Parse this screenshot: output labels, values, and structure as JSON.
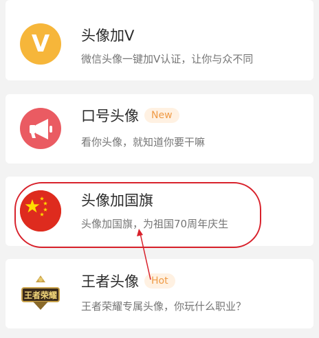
{
  "items": [
    {
      "title": "头像加V",
      "subtitle": "微信头像一键加V认证，让你与众不同",
      "icon": "v-badge-icon",
      "icon_letter": "V",
      "badge": ""
    },
    {
      "title": "口号头像",
      "subtitle": "看你头像，就知道你要干嘛",
      "icon": "megaphone-icon",
      "badge": "New"
    },
    {
      "title": "头像加国旗",
      "subtitle": "头像加国旗，为祖国70周年庆生",
      "icon": "china-flag-icon",
      "badge": ""
    },
    {
      "title": "王者头像",
      "subtitle": "王者荣耀专属头像，你玩什么职业？",
      "icon": "king-glory-logo-icon",
      "badge": "Hot",
      "logo_text": "王者荣耀"
    }
  ],
  "colors": {
    "background": "#f3f3f3",
    "card": "#ffffff",
    "v_icon": "#f6b63a",
    "megaphone_icon": "#ea5b62",
    "flag_red": "#de2b1e",
    "flag_star": "#ffde00",
    "badge_bg": "#fff1e2",
    "badge_text": "#ef9a45",
    "annotation": "#d8212b"
  }
}
